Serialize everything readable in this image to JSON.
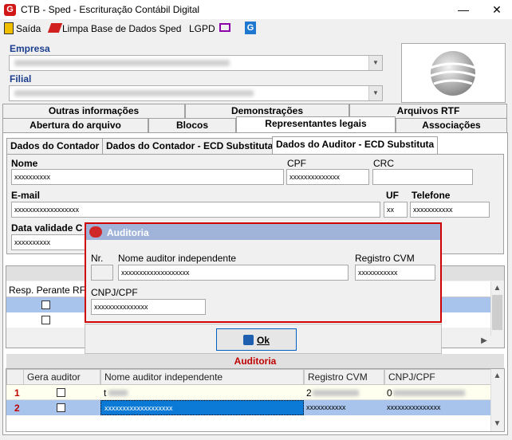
{
  "window": {
    "title": "CTB - Sped - Escrituração Contábil Digital",
    "minimize": "—",
    "close": "✕"
  },
  "menu": {
    "exit": "Saída",
    "clear_db": "Limpa Base de Dados Sped",
    "lgpd": "LGPD"
  },
  "company": {
    "empresa_label": "Empresa",
    "filial_label": "Filial"
  },
  "tabs_row1": [
    "Outras informações",
    "Demonstrações",
    "Arquivos RTF"
  ],
  "tabs_row2": [
    "Abertura do arquivo",
    "Blocos",
    "Representantes legais",
    "Associações"
  ],
  "subtabs": [
    "Dados do Contador",
    "Dados do Contador - ECD Substituta",
    "Dados do Auditor - ECD Substituta"
  ],
  "form": {
    "nome_label": "Nome",
    "nome_value": "xxxxxxxxxx",
    "cpf_label": "CPF",
    "cpf_value": "xxxxxxxxxxxxxx",
    "crc_label": "CRC",
    "email_label": "E-mail",
    "email_value": "xxxxxxxxxxxxxxxxxx",
    "uf_label": "UF",
    "uf_value": "xx",
    "telefone_label": "Telefone",
    "telefone_value": "xxxxxxxxxxx",
    "data_validade_label": "Data validade C",
    "data_validade_value": "xxxxxxxxxx"
  },
  "resp_grid": {
    "header": "Resp. Perante RFB"
  },
  "dialog": {
    "title": "Auditoria",
    "nr_label": "Nr.",
    "nome_label": "Nome auditor independente",
    "nome_value": "xxxxxxxxxxxxxxxxxxx",
    "registro_label": "Registro CVM",
    "registro_value": "xxxxxxxxxxx",
    "cnpj_label": "CNPJ/CPF",
    "cnpj_value": "xxxxxxxxxxxxxxx",
    "ok_label": "Ok"
  },
  "auditoria_grid": {
    "title": "Auditoria",
    "columns": [
      "Gera auditor",
      "Nome auditor independente",
      "Registro CVM",
      "CNPJ/CPF"
    ],
    "rows": [
      {
        "nr": "1",
        "nome": "t",
        "registro": "2",
        "cnpj": "0"
      },
      {
        "nr": "2",
        "nome": "xxxxxxxxxxxxxxxxxxx",
        "registro": "xxxxxxxxxxx",
        "cnpj": "xxxxxxxxxxxxxxx"
      }
    ]
  },
  "colors": {
    "accent_red": "#d00000",
    "selected_row": "#0a7ad6",
    "selected_row_light": "#a8c4ec",
    "title_red": "#c00000"
  }
}
